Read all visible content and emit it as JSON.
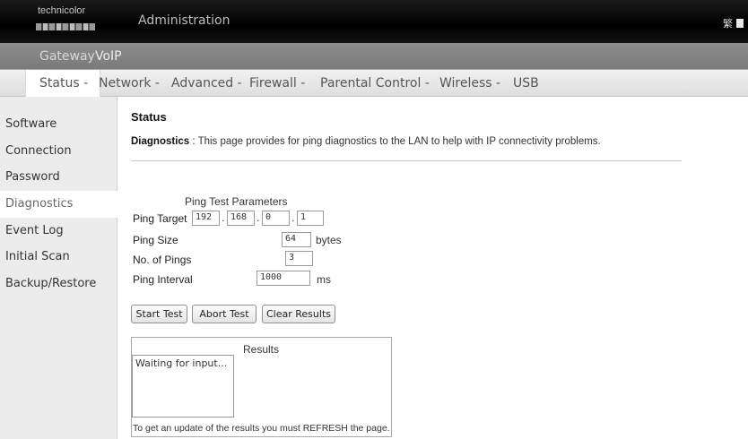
{
  "header": {
    "brand": "technicolor",
    "title": "Administration",
    "language_icon": "language-icon"
  },
  "top_nav": [
    "Gateway",
    "VoIP"
  ],
  "menu": {
    "items": [
      "Status",
      "Network",
      "Advanced",
      "Firewall",
      "Parental Control",
      "Wireless",
      "USB"
    ],
    "separator": "-",
    "active": "Status"
  },
  "sidebar": {
    "items": [
      "Software",
      "Connection",
      "Password",
      "Diagnostics",
      "Event Log",
      "Initial Scan",
      "Backup/Restore"
    ],
    "active": "Diagnostics"
  },
  "main": {
    "title": "Status",
    "desc_label": "Diagnostics",
    "desc_text": ":  This page provides for ping diagnostics to the LAN to help with IP connectivity problems.",
    "params_title": "Ping Test Parameters",
    "ping_target_label": "Ping Target",
    "ping_target": [
      "192",
      "168",
      "0",
      "1"
    ],
    "ping_size_label": "Ping Size",
    "ping_size": "64",
    "ping_size_unit": "bytes",
    "num_pings_label": "No. of Pings",
    "num_pings": "3",
    "interval_label": "Ping Interval",
    "interval": "1000",
    "interval_unit": "ms",
    "buttons": {
      "start": "Start Test",
      "abort": "Abort Test",
      "clear": "Clear Results"
    },
    "results_title": "Results",
    "results_text": "Waiting for input...",
    "results_note": "To get an update of the results you must REFRESH the page."
  }
}
